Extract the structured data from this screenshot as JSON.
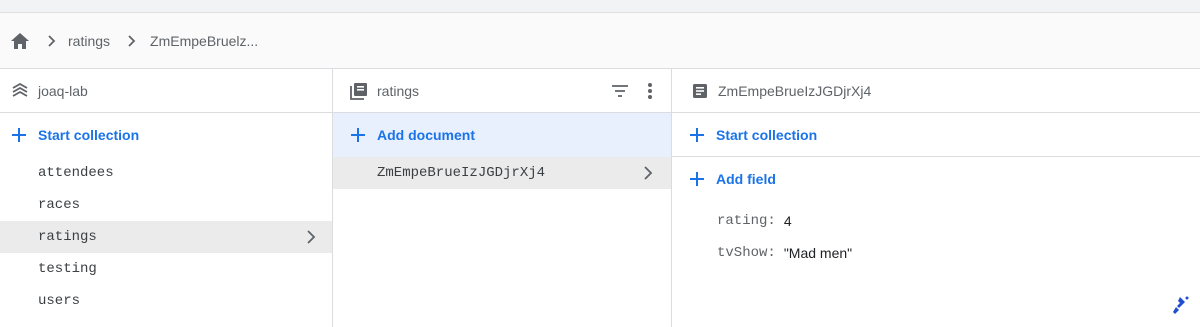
{
  "breadcrumb": {
    "home_icon": "home-icon",
    "items": [
      "ratings",
      "ZmEmpeBruelz..."
    ]
  },
  "project": {
    "name": "joaq-lab",
    "icon": "firebase-project-icon",
    "start_collection_label": "Start collection",
    "collections": [
      "attendees",
      "races",
      "ratings",
      "testing",
      "users"
    ],
    "selected_collection": "ratings"
  },
  "collection": {
    "name": "ratings",
    "icon": "collection-icon",
    "add_document_label": "Add document",
    "documents": [
      "ZmEmpeBrueIzJGDjrXj4"
    ],
    "selected_document": "ZmEmpeBrueIzJGDjrXj4"
  },
  "document": {
    "name": "ZmEmpeBrueIzJGDjrXj4",
    "icon": "document-icon",
    "start_collection_label": "Start collection",
    "add_field_label": "Add field",
    "fields": [
      {
        "key": "rating:",
        "value": "4"
      },
      {
        "key": "tvShow:",
        "value": "\"Mad men\""
      }
    ]
  },
  "colors": {
    "accent": "#1a73e8",
    "highlight": "#e8f0fe",
    "selected": "#ebebeb"
  }
}
